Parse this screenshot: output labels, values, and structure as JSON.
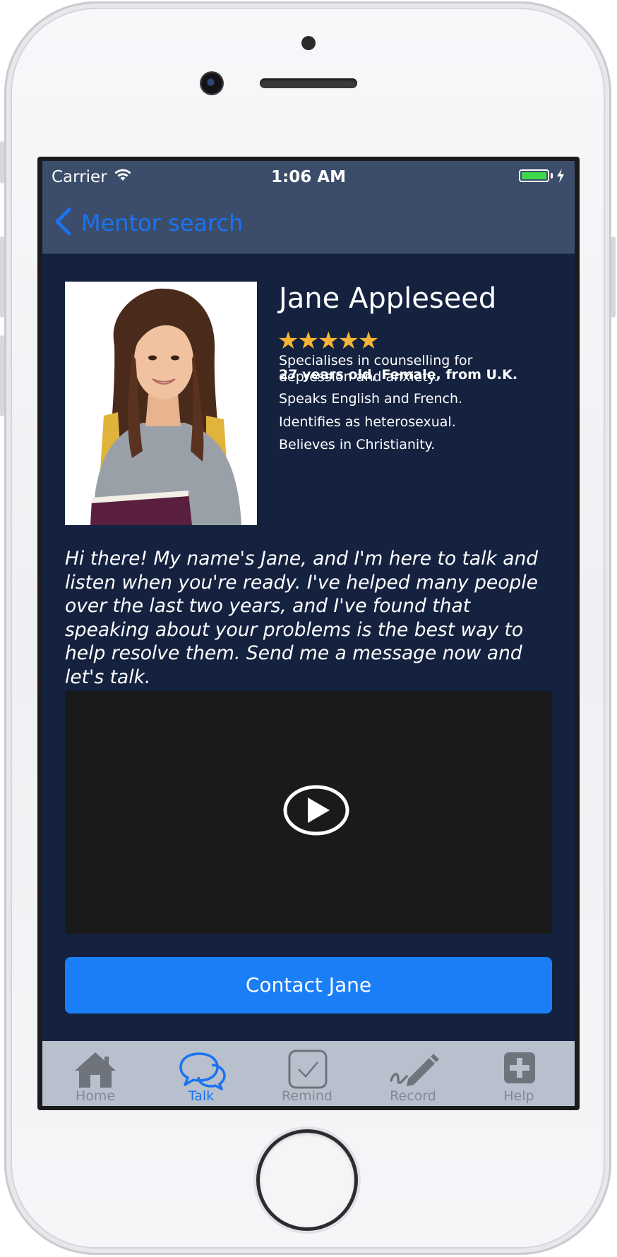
{
  "status_bar": {
    "carrier": "Carrier",
    "time": "1:06 AM",
    "battery_color": "#3fd84b"
  },
  "nav": {
    "back_label": "Mentor search",
    "back_icon": "chevron-left-icon"
  },
  "profile": {
    "name": "Jane Appleseed",
    "rating": 5,
    "rating_max": 5,
    "stars_text": "★★★★★",
    "details": "27 years old, Female, from U.K.",
    "specialisation": "Specialises in counselling for depression and anxiety.",
    "languages": "Speaks English and French.",
    "orientation": "Identifies as heterosexual.",
    "religion": "Believes in Christianity."
  },
  "bio": "Hi there! My name's Jane, and I'm here to talk and listen when you're ready. I've helped many people over the last two years, and I've found that speaking about your problems is the best way to help resolve them. Send me a message now and let's talk.",
  "video": {
    "icon": "play-icon"
  },
  "contact_button": "Contact Jane",
  "tabs": [
    {
      "label": "Home",
      "icon": "home-icon",
      "active": false
    },
    {
      "label": "Talk",
      "icon": "chat-bubbles-icon",
      "active": true
    },
    {
      "label": "Remind",
      "icon": "checkbox-icon",
      "active": false
    },
    {
      "label": "Record",
      "icon": "pen-icon",
      "active": false
    },
    {
      "label": "Help",
      "icon": "plus-icon",
      "active": false
    }
  ],
  "colors": {
    "accent": "#1a73f2",
    "button": "#1a7ef7",
    "background": "#14223f",
    "navbar": "#3b4d6a",
    "tabbar": "#b8c0cd",
    "stars": "#f5b435"
  }
}
